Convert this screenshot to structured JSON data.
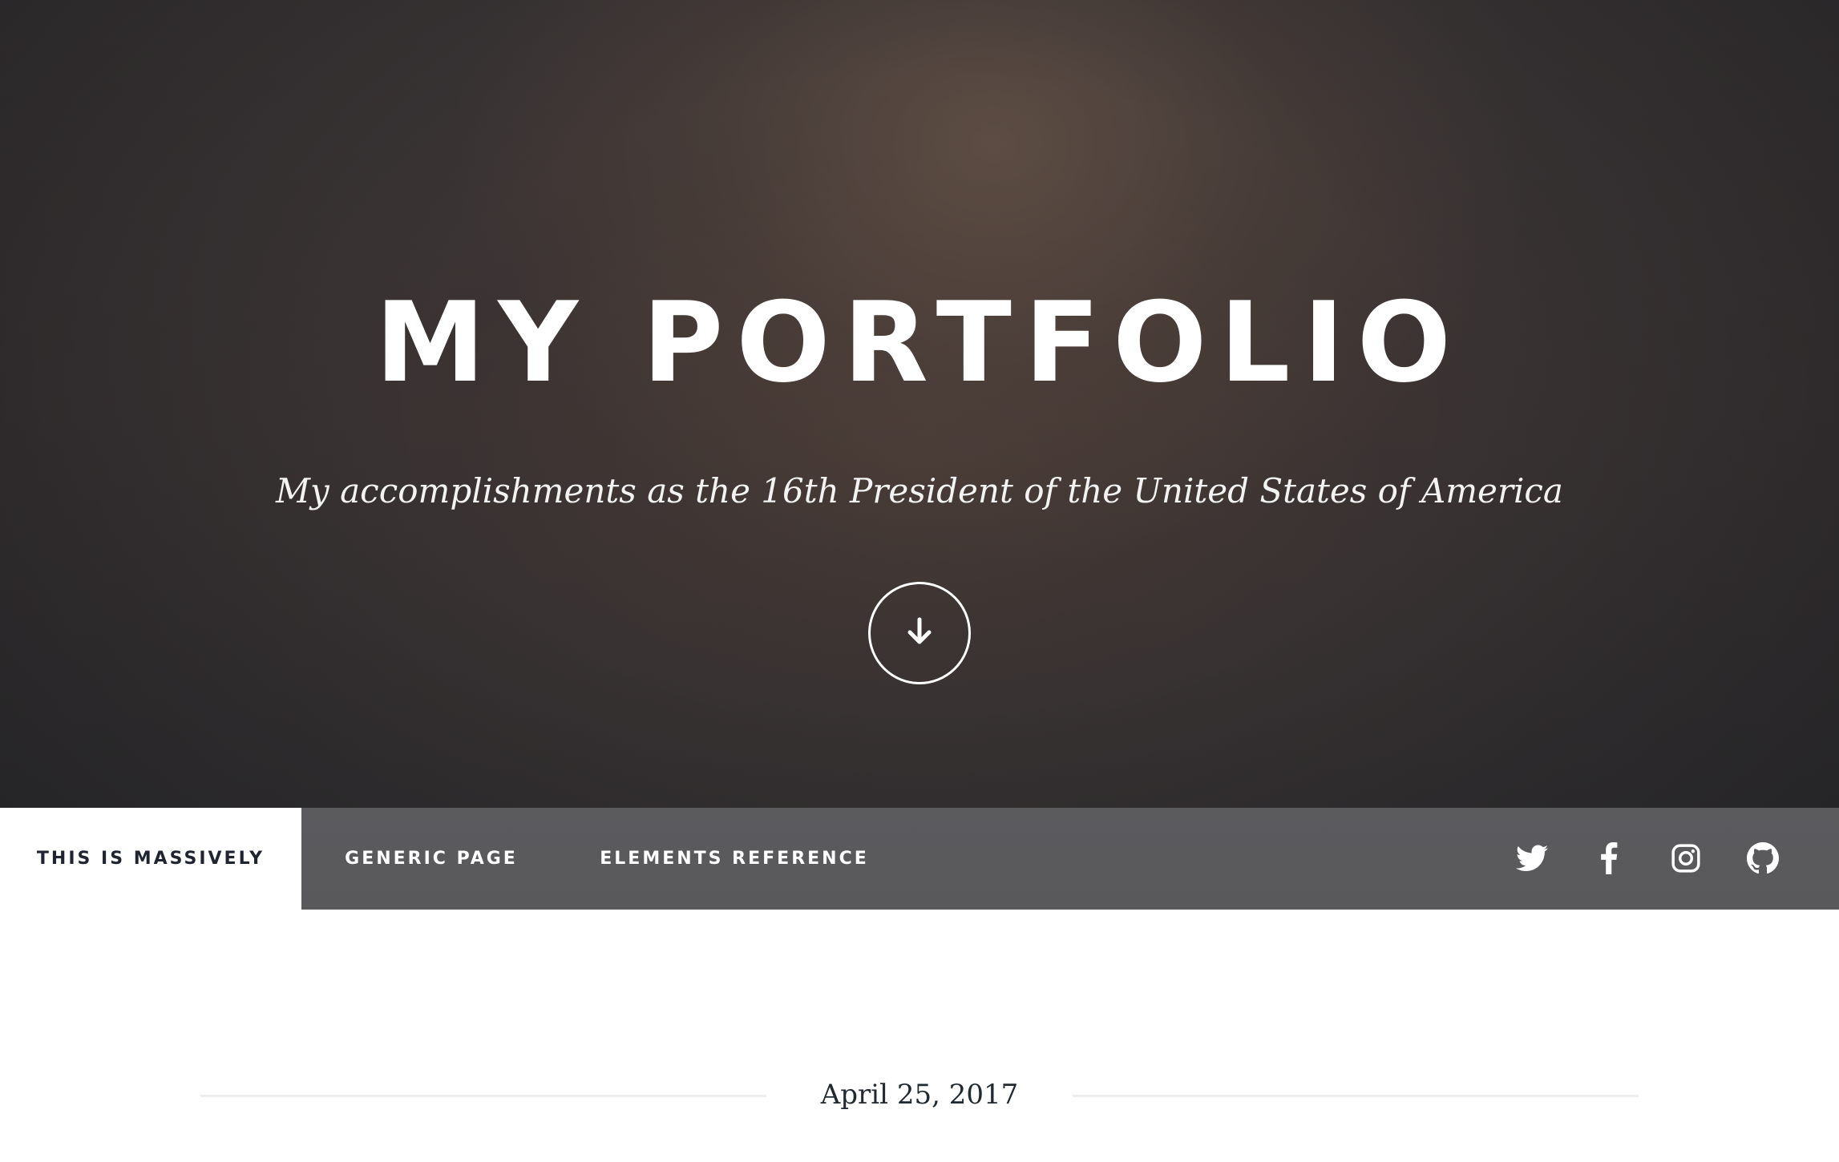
{
  "hero": {
    "title": "MY PORTFOLIO",
    "subtitle": "My accomplishments as the 16th President of the United States of America",
    "scroll_icon": "arrow-down-icon"
  },
  "nav": {
    "items": [
      {
        "label": "This is Massively",
        "active": true
      },
      {
        "label": "Generic Page",
        "active": false
      },
      {
        "label": "Elements Reference",
        "active": false
      }
    ],
    "social": [
      {
        "icon": "twitter-icon"
      },
      {
        "icon": "facebook-icon"
      },
      {
        "icon": "instagram-icon"
      },
      {
        "icon": "github-icon"
      }
    ]
  },
  "post": {
    "date": "April 25, 2017"
  },
  "colors": {
    "nav_background": "#59595c",
    "nav_active_background": "#ffffff",
    "nav_active_text": "#1f2430",
    "text_dark": "#212931",
    "divider": "#eeeeee"
  }
}
